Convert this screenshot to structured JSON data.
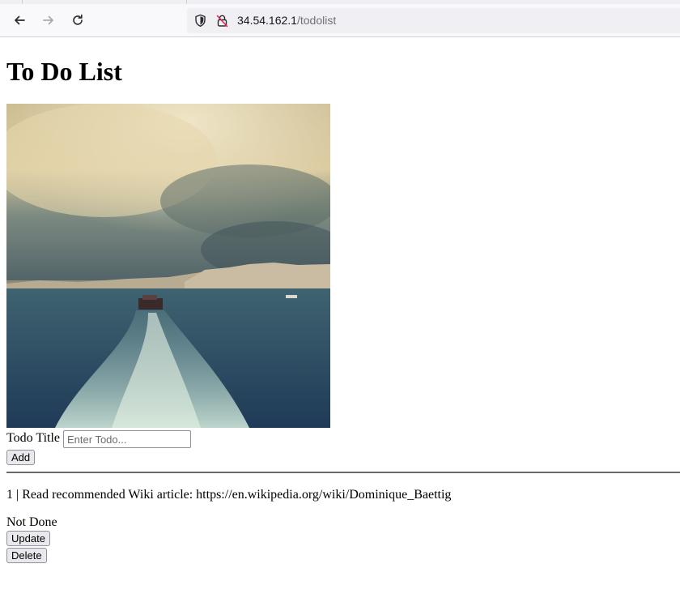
{
  "browser": {
    "url_host": "34.54.162.1",
    "url_path": "/todolist"
  },
  "page": {
    "title": "To Do List",
    "image_description": "Photo of a boat's wake on the sea with a city skyline under dramatic clouds"
  },
  "form": {
    "label": "Todo Title",
    "placeholder": "Enter Todo...",
    "value": "",
    "add_label": "Add"
  },
  "todos": [
    {
      "text": "1 | Read recommended Wiki article: https://en.wikipedia.org/wiki/Dominique_Baettig",
      "status": "Not Done",
      "update_label": "Update",
      "delete_label": "Delete"
    }
  ],
  "colors": {
    "chrome_bg": "#f9f9fb",
    "urlbar_bg": "#f0f0f4",
    "button_bg": "#e9e9ed"
  }
}
